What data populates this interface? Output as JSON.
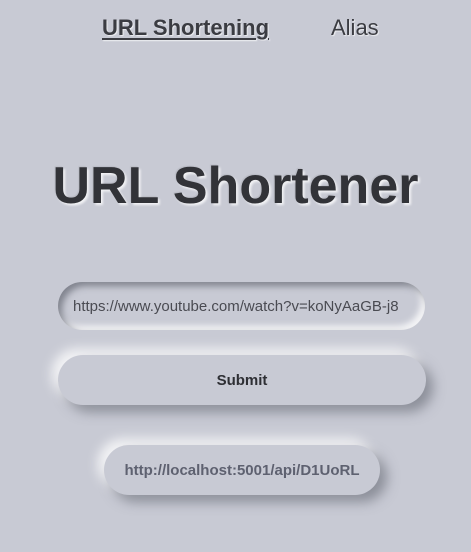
{
  "nav": {
    "items": [
      {
        "label": "URL Shortening",
        "active": true
      },
      {
        "label": "Alias",
        "active": false
      }
    ]
  },
  "main": {
    "title": "URL Shortener",
    "url_input": {
      "value": "https://www.youtube.com/watch?v=koNyAaGB-j8",
      "placeholder": ""
    },
    "submit_label": "Submit",
    "result_link": "http://localhost:5001/api/D1UoRL"
  },
  "colors": {
    "background": "#c8cad4",
    "title_text": "#323338",
    "result_link": "#5e6170"
  }
}
